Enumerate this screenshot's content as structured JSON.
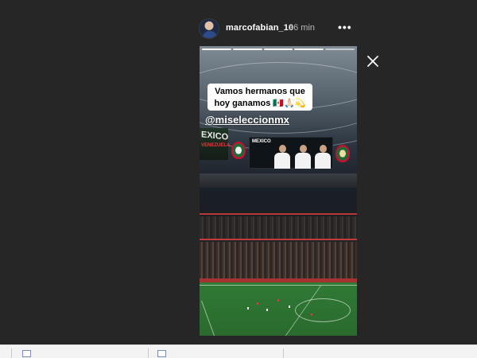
{
  "story": {
    "username": "marcofabian_10",
    "time_ago": "36 min",
    "more_icon": "•••",
    "close_icon": "close-icon",
    "progress_segments": 5,
    "progress_done": 4,
    "caption_line1": "Vamos hermanos que",
    "caption_line2": "hoy ganamos 🇲🇽🙏🏻💫",
    "mention": "@miseleccionmx"
  },
  "jumbotron": {
    "left_text": "EXICO",
    "left_subtext": "VENEZUELA",
    "main_title": "MEXICO"
  },
  "colors": {
    "background": "#262626",
    "pitch_green": "#2f7a34",
    "accent_red": "#c8102e"
  }
}
